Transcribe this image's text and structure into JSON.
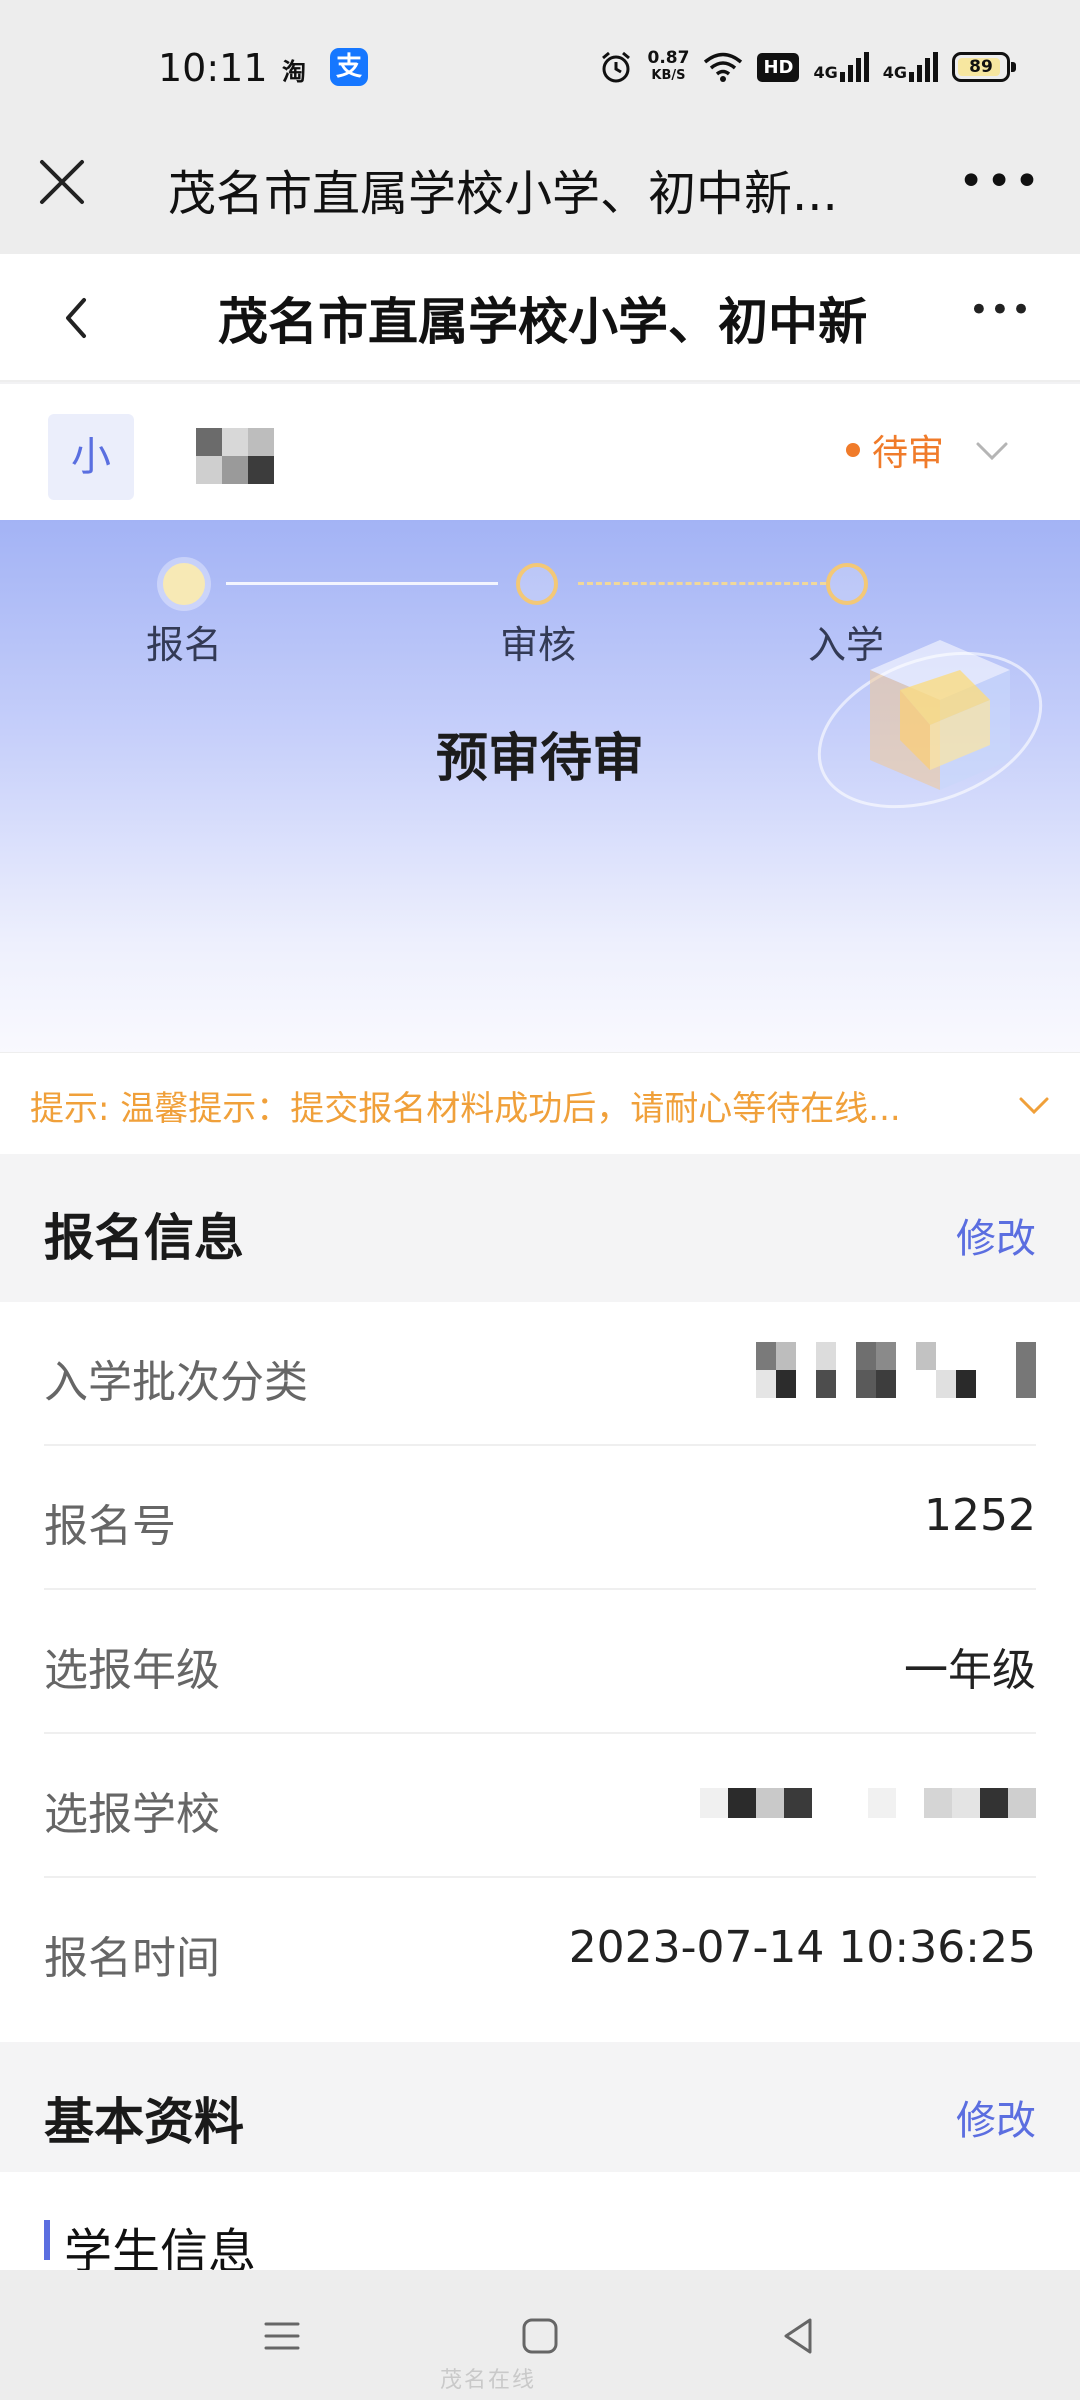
{
  "status_bar": {
    "time": "10:11",
    "app_icon_1": "淘",
    "app_icon_2": "支",
    "net_speed": "0.87",
    "net_unit": "KB/S",
    "hd_label": "HD",
    "signal_1": "4G",
    "signal_2": "4G",
    "battery": "89"
  },
  "top_bar": {
    "title": "茂名市直属学校小学、初中新..."
  },
  "inner_header": {
    "title": "茂名市直属学校小学、初中新"
  },
  "student": {
    "avatar_text": "小",
    "status": "待审",
    "status_color": "#f07b2a"
  },
  "progress": {
    "steps": [
      "报名",
      "审核",
      "入学"
    ],
    "stage_title": "预审待审"
  },
  "tip": {
    "text": "提示:  温馨提示：提交报名材料成功后，请耐心等待在线..."
  },
  "registration": {
    "heading": "报名信息",
    "edit_label": "修改",
    "fields": [
      {
        "label": "入学批次分类",
        "value": ""
      },
      {
        "label": "报名号",
        "value": "1252"
      },
      {
        "label": "选报年级",
        "value": "一年级"
      },
      {
        "label": "选报学校",
        "value": ""
      },
      {
        "label": "报名时间",
        "value": "2023-07-14 10:36:25"
      }
    ]
  },
  "basic": {
    "heading": "基本资料",
    "edit_label": "修改",
    "subsection": "学生信息"
  },
  "watermark": "茂名在线",
  "colors": {
    "accent": "#5b6ee0",
    "tip": "#f0a03a"
  }
}
